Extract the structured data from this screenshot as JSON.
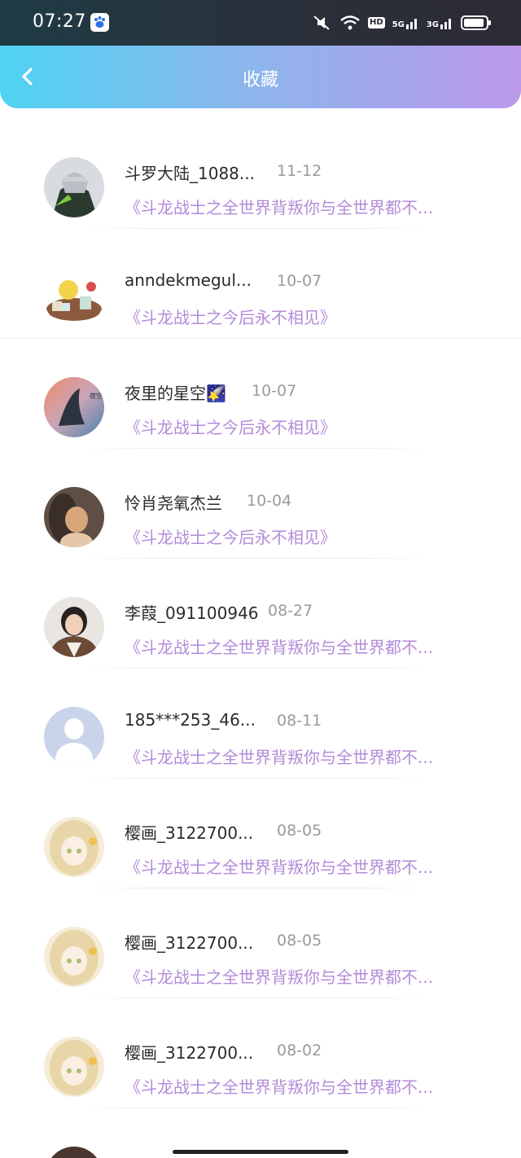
{
  "status_bar": {
    "time": "07:27",
    "hd_label": "HD",
    "network1": "5G",
    "network2": "3G"
  },
  "header": {
    "title": "收藏"
  },
  "colors": {
    "header_gradient_start": "#4ed3f2",
    "header_gradient_end": "#bb98ea",
    "quote_color": "#b38bd8"
  },
  "items": [
    {
      "name": "斗罗大陆_1088...",
      "date": "11-12",
      "quote": "《斗龙战士之全世界背叛你与全世界都不...",
      "avatar": "anime-boy-avatar"
    },
    {
      "name": "anndekmegul...",
      "date": "10-07",
      "quote": "《斗龙战士之今后永不相见》",
      "avatar": "cartoon-food-avatar"
    },
    {
      "name": "夜里的星空🌠",
      "date": "10-07",
      "quote": "《斗龙战士之今后永不相见》",
      "avatar": "whale-sky-avatar"
    },
    {
      "name": "怜肖尧氧杰兰",
      "date": "10-04",
      "quote": "《斗龙战士之今后永不相见》",
      "avatar": "girl-photo-avatar"
    },
    {
      "name": "李葭_091100946",
      "date": "08-27",
      "quote": "《斗龙战士之全世界背叛你与全世界都不...",
      "avatar": "child-photo-avatar"
    },
    {
      "name": "185***253_46...",
      "date": "08-11",
      "quote": "《斗龙战士之全世界背叛你与全世界都不...",
      "avatar": "default-user-avatar"
    },
    {
      "name": "樱画_3122700...",
      "date": "08-05",
      "quote": "《斗龙战士之全世界背叛你与全世界都不...",
      "avatar": "anime-girl-avatar"
    },
    {
      "name": "樱画_3122700...",
      "date": "08-05",
      "quote": "《斗龙战士之全世界背叛你与全世界都不...",
      "avatar": "anime-girl-avatar"
    },
    {
      "name": "樱画_3122700...",
      "date": "08-02",
      "quote": "《斗龙战士之全世界背叛你与全世界都不...",
      "avatar": "anime-girl-avatar"
    }
  ]
}
